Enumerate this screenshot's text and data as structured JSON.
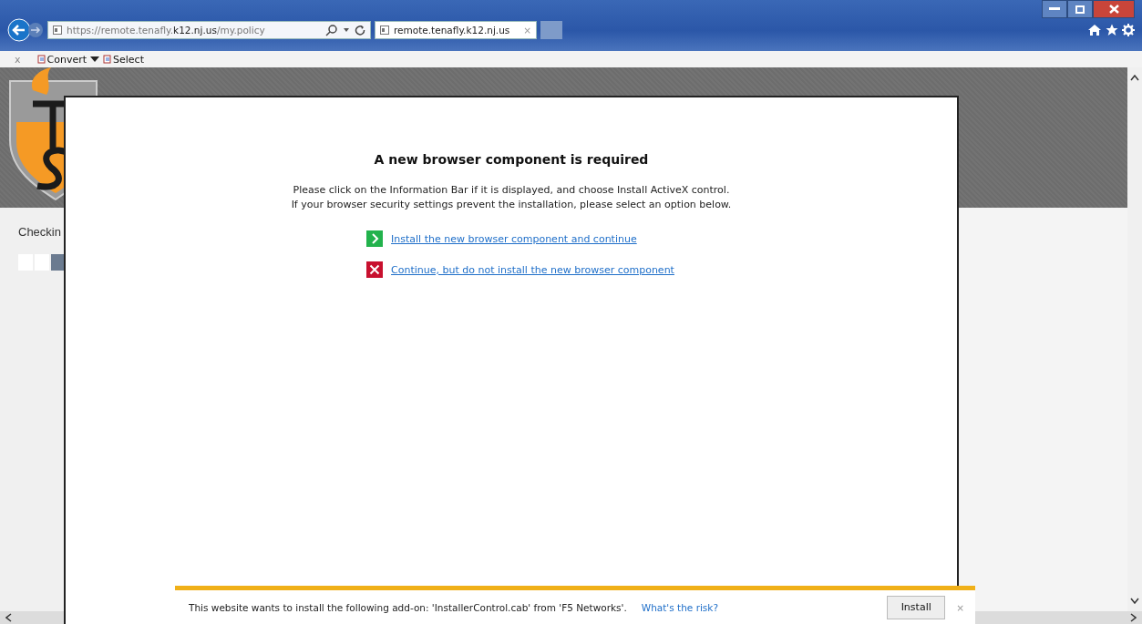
{
  "browser": {
    "address": {
      "prefix": "https://remote.tenafly.",
      "host": "k12.nj.us",
      "path": "/my.policy"
    },
    "tab": {
      "title": "remote.tenafly.k12.nj.us",
      "close": "×"
    },
    "command_bar": {
      "close": "x",
      "items": [
        {
          "label": "Convert",
          "dropdown": true
        },
        {
          "label": "Select",
          "dropdown": false
        }
      ]
    }
  },
  "page": {
    "status": "Checkin",
    "progress": [
      {
        "on": false
      },
      {
        "on": false
      },
      {
        "on": true
      }
    ]
  },
  "dialog": {
    "title": "A new browser component is required",
    "lines": [
      "Please click on the Information Bar if it is displayed, and choose Install ActiveX control.",
      "If your browser security settings prevent the installation, please select an option below."
    ],
    "options": [
      {
        "kind": "install",
        "label": "Install the new browser component and continue"
      },
      {
        "kind": "skip",
        "label": "Continue, but do not install the new browser component"
      }
    ]
  },
  "notification": {
    "message": "This website wants to install the following add-on: 'InstallerControl.cab' from 'F5 Networks'.",
    "link": "What's the risk?",
    "button": "Install",
    "close": "×"
  }
}
